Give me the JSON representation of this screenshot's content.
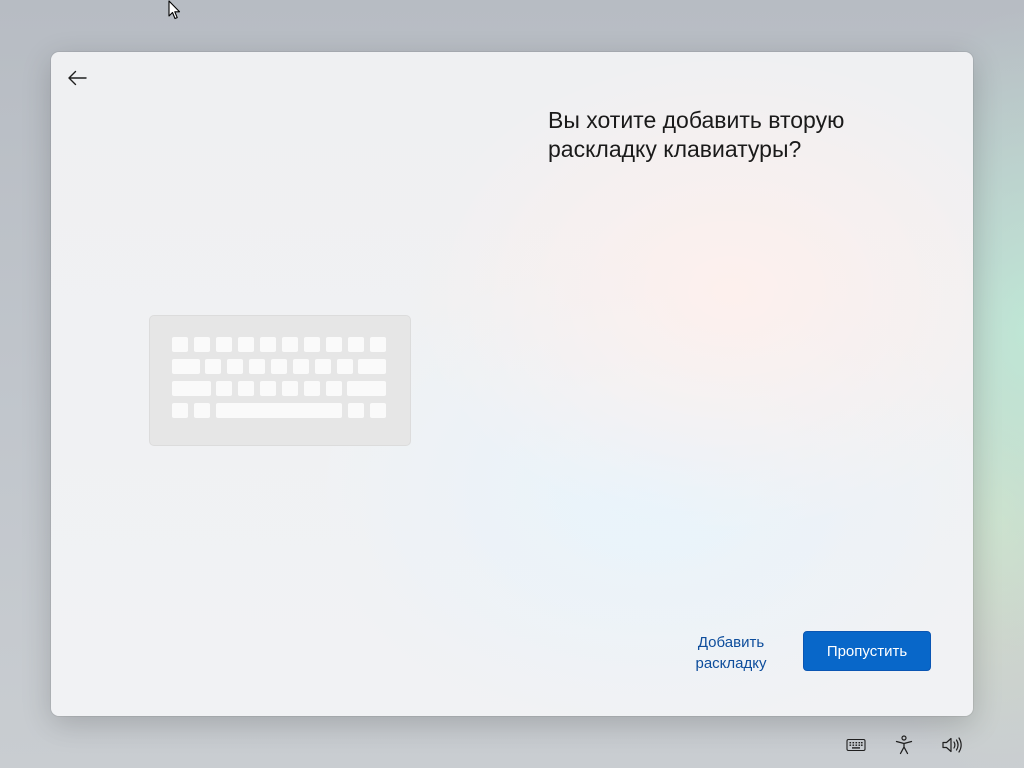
{
  "page": {
    "title": "Вы хотите добавить вторую раскладку клавиатуры?"
  },
  "back_button": {
    "icon": "arrow-left-icon"
  },
  "illustration": {
    "icon": "keyboard-illustration"
  },
  "actions": {
    "add_layout_label": "Добавить раскладку",
    "skip_label": "Пропустить"
  },
  "taskbar": {
    "icons": [
      "keyboard-icon",
      "accessibility-icon",
      "volume-icon"
    ]
  },
  "colors": {
    "accent": "#0867c9",
    "link": "#0d4d9c",
    "title_text": "#1a1a1a"
  }
}
